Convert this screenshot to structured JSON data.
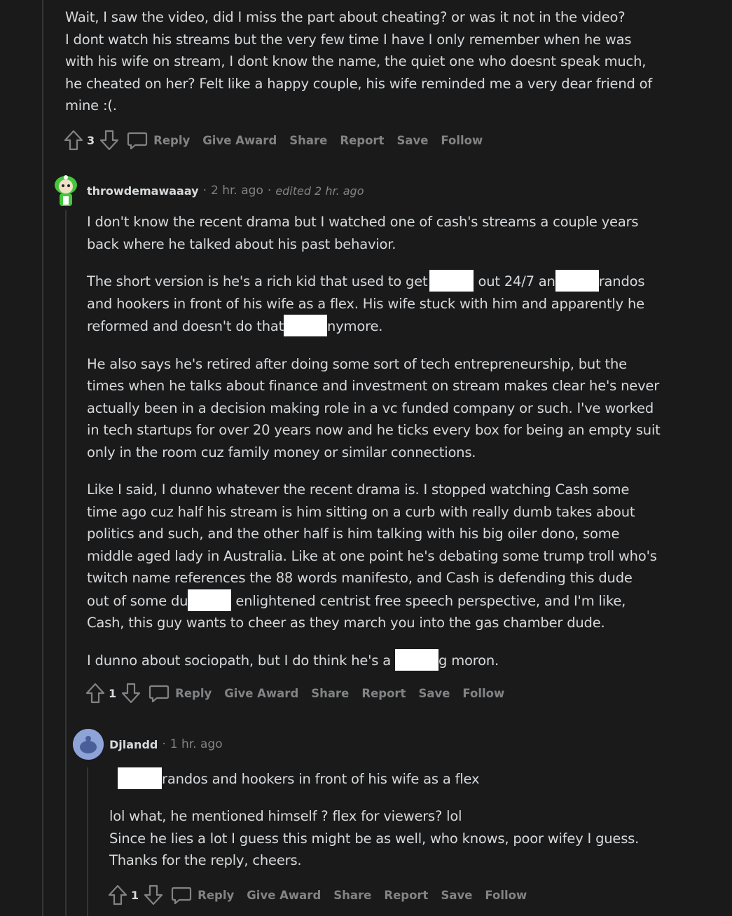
{
  "top_comment": {
    "text": "Wait, I saw the video, did I miss the part about cheating? or was it not in the video?\nI dont watch his streams but the very few time I have I only remember when he was with his wife on stream, I dont know the name, the quiet one who doesnt speak much, he cheated on her? Felt like a happy couple, his wife reminded me a very dear friend of mine :(.",
    "line1": "Wait, I saw the video, did I miss the part about cheating? or was it not in the video?",
    "line2": "I dont watch his streams but the very few time I have I only remember when he was",
    "line3": "with his wife on stream, I dont know the name, the quiet one who doesnt speak much,",
    "line4": "he cheated on her? Felt like a happy couple, his wife reminded me a very dear friend of",
    "line5": "mine :(.",
    "score": "3"
  },
  "actions": {
    "reply": "Reply",
    "give_award": "Give Award",
    "share": "Share",
    "report": "Report",
    "save": "Save",
    "follow": "Follow"
  },
  "comment2": {
    "username": "throwdemawaaay",
    "time": "2 hr. ago",
    "edited": "edited 2 hr. ago",
    "p1_l1": "I don't know the recent drama but I watched one of cash's streams a couple years",
    "p1_l2": "back where he talked about his past behavior.",
    "p2_l1_a": "The short version is he's a rich kid that used to get",
    "p2_l1_b": "out 24/7 an",
    "p2_l1_c": "randos",
    "p2_l2": "and hookers in front of his wife as a flex. His wife stuck with him and apparently he",
    "p2_l3_a": "reformed and doesn't do that",
    "p2_l3_b": "nymore.",
    "p3_l1": "He also says he's retired after doing some sort of tech entrepreneurship, but the",
    "p3_l2": "times when he talks about finance and investment on stream makes clear he's never",
    "p3_l3": "actually been in a decision making role in a vc funded company or such. I've worked",
    "p3_l4": "in tech startups for over 20 years now and he ticks every box for being an empty suit",
    "p3_l5": "only in the room cuz family money or similar connections.",
    "p4_l1": "Like I said, I dunno whatever the recent drama is. I stopped watching Cash some",
    "p4_l2": "time ago cuz half his stream is him sitting on a curb with really dumb takes about",
    "p4_l3": "politics and such, and the other half is him talking with his big oiler dono, some",
    "p4_l4": "middle aged lady in Australia. Like at one point he's debating some trump troll who's",
    "p4_l5": "twitch name references the 88 words manifesto, and Cash is defending this dude",
    "p4_l6_a": "out of some du",
    "p4_l6_b": "enlightened centrist free speech perspective, and I'm like,",
    "p4_l7": "Cash, this guy wants to cheer as they march you into the gas chamber dude.",
    "p5_a": "I dunno about sociopath, but I do think he's a",
    "p5_b": "g moron.",
    "score": "1"
  },
  "comment3": {
    "username": "Djlandd",
    "time": "1 hr. ago",
    "quote": "randos and hookers in front of his wife as a flex",
    "l1": "lol what, he mentioned himself ? flex for viewers? lol",
    "l2": "Since he lies a lot I guess this might be as well, who knows, poor wifey I guess.",
    "l3": "Thanks for the reply, cheers.",
    "score": "1"
  },
  "colors": {
    "background": "#1a1a1b",
    "text": "#d7dadc",
    "muted": "#818384",
    "thread_line": "#343536"
  }
}
